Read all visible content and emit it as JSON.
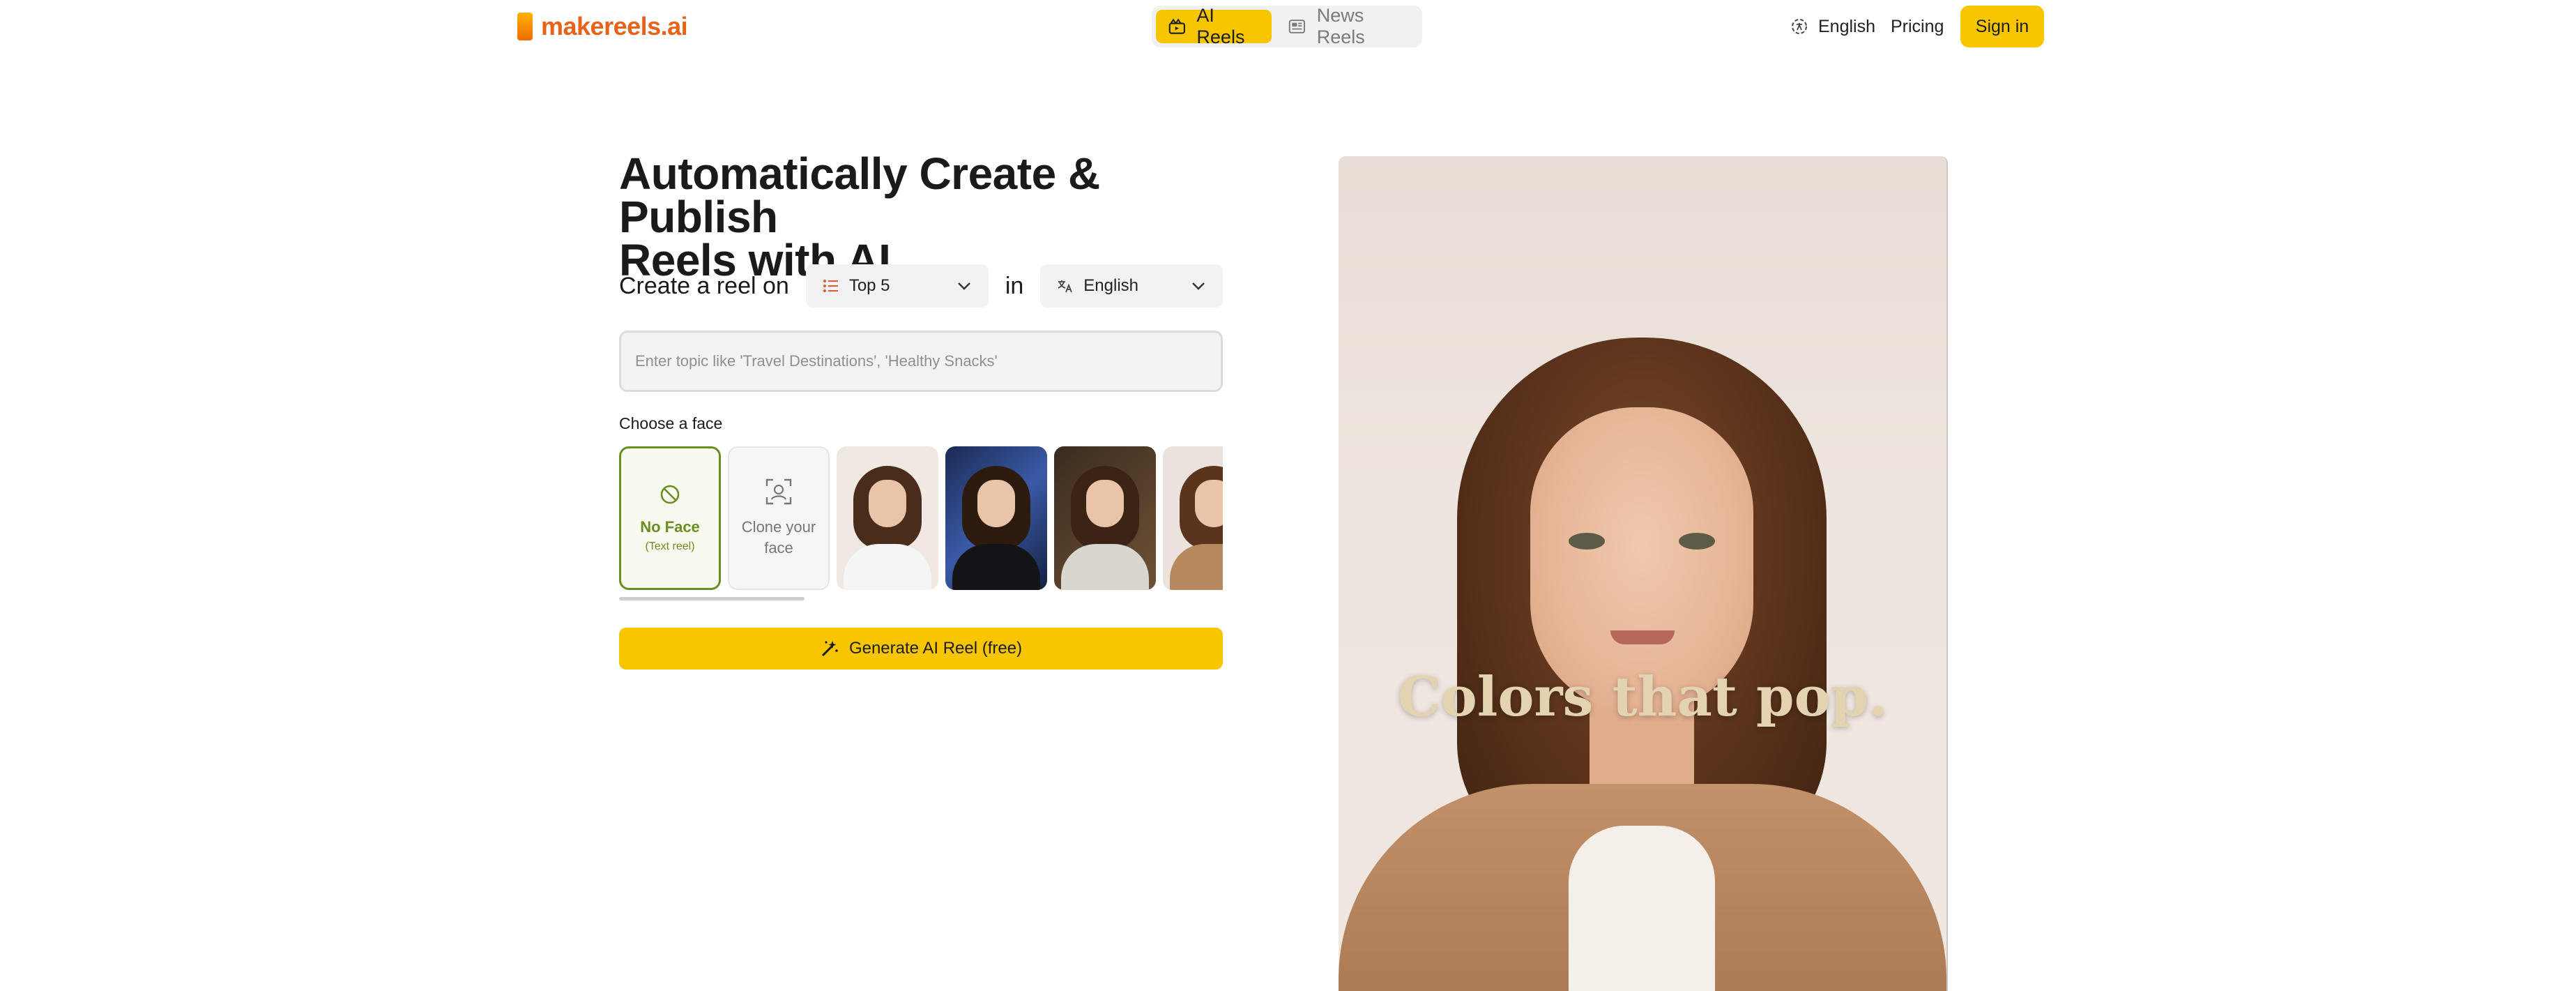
{
  "header": {
    "logo_text": "makereels.ai",
    "tabs": [
      {
        "label": "AI Reels",
        "icon": "reel-camera-icon",
        "active": true
      },
      {
        "label": "News Reels",
        "icon": "newspaper-icon",
        "active": false
      }
    ],
    "language": "English",
    "pricing": "Pricing",
    "signin": "Sign in"
  },
  "hero": {
    "title_line1": "Automatically Create & Publish",
    "title_line2": "Reels with AI"
  },
  "create": {
    "label": "Create a reel on",
    "format_value": "Top 5",
    "in_label": "in",
    "language_value": "English"
  },
  "topic": {
    "placeholder": "Enter topic like 'Travel Destinations', 'Healthy Snacks'",
    "value": ""
  },
  "faces": {
    "label": "Choose a face",
    "no_face_title": "No Face",
    "no_face_sub": "(Text reel)",
    "clone_label": "Clone your face",
    "selected": "No Face"
  },
  "generate": {
    "label": "Generate AI Reel (free)"
  },
  "preview": {
    "caption": "Colors that pop."
  },
  "colors": {
    "accent": "#f7c600",
    "brand": "#e8621a",
    "selected_border": "#6b8e23"
  }
}
